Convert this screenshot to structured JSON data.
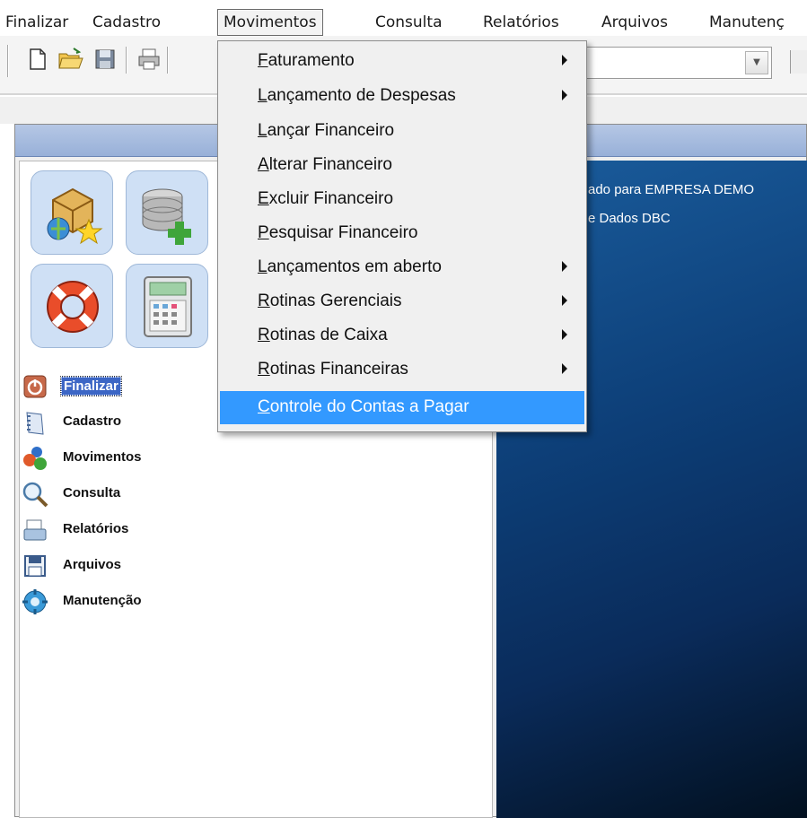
{
  "menubar": {
    "items": [
      "Finalizar",
      "Cadastro",
      "Movimentos",
      "Consulta",
      "Relatórios",
      "Arquivos",
      "Manutenç"
    ]
  },
  "toolbar": {
    "icons": [
      "new-document-icon",
      "open-folder-icon",
      "save-icon",
      "print-icon"
    ],
    "combo_value": ""
  },
  "dropdown": {
    "items": [
      {
        "mnemonic": "F",
        "rest": "aturamento",
        "submenu": true
      },
      {
        "mnemonic": "L",
        "rest": "ançamento de Despesas",
        "submenu": true
      },
      {
        "mnemonic": "L",
        "rest": "ançar Financeiro",
        "submenu": false
      },
      {
        "mnemonic": "A",
        "rest": "lterar Financeiro",
        "submenu": false
      },
      {
        "mnemonic": "E",
        "rest": "xcluir Financeiro",
        "submenu": false
      },
      {
        "mnemonic": "P",
        "rest": "esquisar Financeiro",
        "submenu": false
      },
      {
        "mnemonic": "L",
        "rest": "ançamentos em aberto",
        "submenu": true
      },
      {
        "mnemonic": "R",
        "rest": "otinas Gerenciais",
        "submenu": true
      },
      {
        "mnemonic": "R",
        "rest": "otinas de Caixa",
        "submenu": true
      },
      {
        "mnemonic": "R",
        "rest": "otinas Financeiras",
        "submenu": true
      },
      {
        "mnemonic": "C",
        "rest": "ontrole do Contas a Pagar",
        "submenu": false
      }
    ],
    "highlighted_index": 10
  },
  "tree": {
    "items": [
      "Finalizar",
      "Cadastro",
      "Movimentos",
      "Consulta",
      "Relatórios",
      "Arquivos",
      "Manutenção"
    ],
    "selected_index": 0
  },
  "right_panel": {
    "line1": "ado para EMPRESA DEMO",
    "line2": "e Dados DBC"
  },
  "colors": {
    "menu_highlight": "#3399ff",
    "title_bar": "#a6bde0",
    "tree_selection": "#3c66c5",
    "big_button": "#cfe0f5",
    "right_panel_dark": "#0a2b5a"
  }
}
